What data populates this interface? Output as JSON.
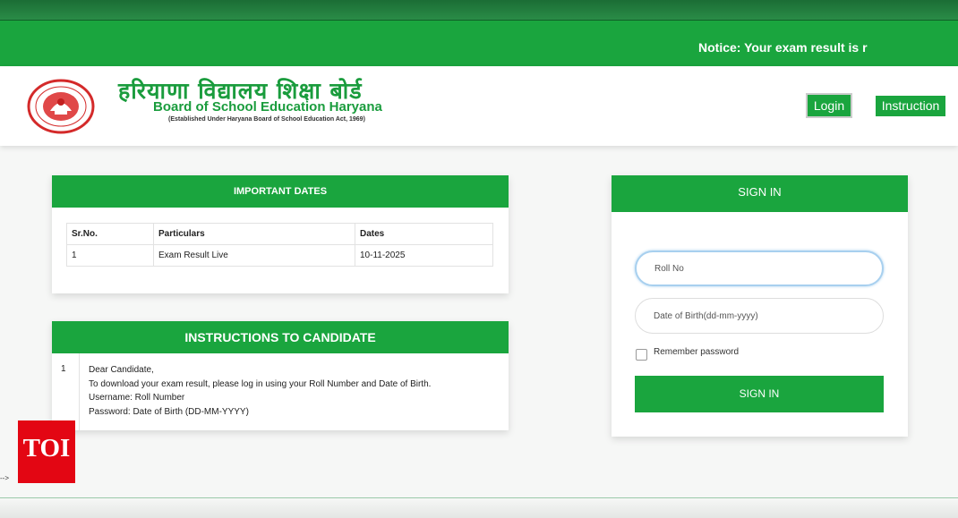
{
  "notice": {
    "text": "Notice: Your exam result is r"
  },
  "header": {
    "hindi_title": "हरियाणा विद्यालय शिक्षा बोर्ड",
    "english_title": "Board of School Education Haryana",
    "subtitle": "(Established Under Haryana Board of School Education Act, 1969)",
    "login_label": "Login",
    "instruction_label": "Instruction",
    "logo_icon": "bseh-seal-logo"
  },
  "important_dates": {
    "title": "IMPORTANT DATES",
    "columns": [
      "Sr.No.",
      "Particulars",
      "Dates"
    ],
    "rows": [
      {
        "sr": "1",
        "particular": "Exam Result Live",
        "date": "10-11-2025"
      }
    ]
  },
  "instructions": {
    "title": "INSTRUCTIONS TO CANDIDATE",
    "number": "1",
    "lines": [
      "Dear Candidate,",
      "To download your exam result, please log in using your Roll Number and Date of Birth.",
      "Username: Roll Number",
      "Password: Date of Birth (DD-MM-YYYY)"
    ]
  },
  "signin": {
    "title": "SIGN IN",
    "roll_placeholder": "Roll No",
    "dob_placeholder": "Date of Birth(dd-mm-yyyy)",
    "remember_label": "Remember password",
    "remember_checked": false,
    "button_label": "SIGN IN"
  },
  "overlay": {
    "watermark": "TOI",
    "comment_text": "-->"
  },
  "colors": {
    "brand_green": "#1aa53e",
    "dark_green": "#1b6d35",
    "watermark_red": "#e30613"
  }
}
